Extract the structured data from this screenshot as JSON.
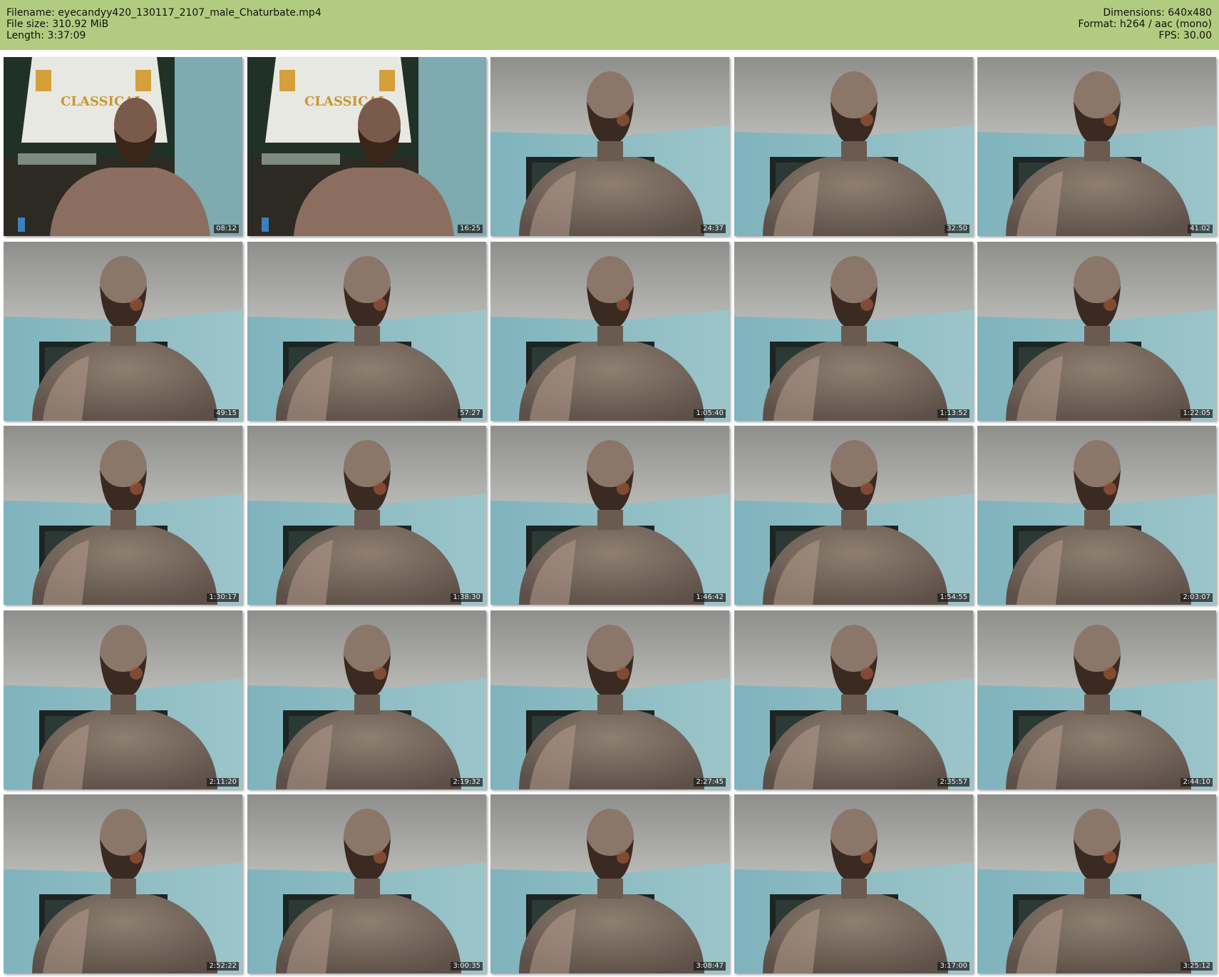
{
  "header": {
    "filename_line": "Filename: eyecandyy420_130117_2107_male_Chaturbate.mp4",
    "filesize_line": "File size: 310.92 MiB",
    "length_line": "Length: 3:37:09",
    "dimensions_line": "Dimensions: 640x480",
    "format_line": "Format: h264 / aac (mono)",
    "fps_line": "FPS: 30.00"
  },
  "colors": {
    "header_bg": "#b1cc80",
    "wall": "#8fb8bf",
    "ceiling": "#a9a9a7"
  },
  "thumbnails": [
    {
      "timestamp": "08:12",
      "scene": "jersey"
    },
    {
      "timestamp": "16:25",
      "scene": "jersey"
    },
    {
      "timestamp": "24:37",
      "scene": "room"
    },
    {
      "timestamp": "32:50",
      "scene": "room"
    },
    {
      "timestamp": "41:02",
      "scene": "room"
    },
    {
      "timestamp": "49:15",
      "scene": "room"
    },
    {
      "timestamp": "57:27",
      "scene": "room"
    },
    {
      "timestamp": "1:05:40",
      "scene": "room"
    },
    {
      "timestamp": "1:13:52",
      "scene": "room"
    },
    {
      "timestamp": "1:22:05",
      "scene": "room"
    },
    {
      "timestamp": "1:30:17",
      "scene": "room"
    },
    {
      "timestamp": "1:38:30",
      "scene": "room"
    },
    {
      "timestamp": "1:46:42",
      "scene": "room"
    },
    {
      "timestamp": "1:54:55",
      "scene": "room"
    },
    {
      "timestamp": "2:03:07",
      "scene": "room"
    },
    {
      "timestamp": "2:11:20",
      "scene": "room"
    },
    {
      "timestamp": "2:19:32",
      "scene": "room"
    },
    {
      "timestamp": "2:27:45",
      "scene": "room"
    },
    {
      "timestamp": "2:35:57",
      "scene": "room"
    },
    {
      "timestamp": "2:44:10",
      "scene": "room"
    },
    {
      "timestamp": "2:52:22",
      "scene": "room"
    },
    {
      "timestamp": "3:00:35",
      "scene": "room"
    },
    {
      "timestamp": "3:08:47",
      "scene": "room"
    },
    {
      "timestamp": "3:17:00",
      "scene": "room"
    },
    {
      "timestamp": "3:25:12",
      "scene": "room"
    }
  ]
}
